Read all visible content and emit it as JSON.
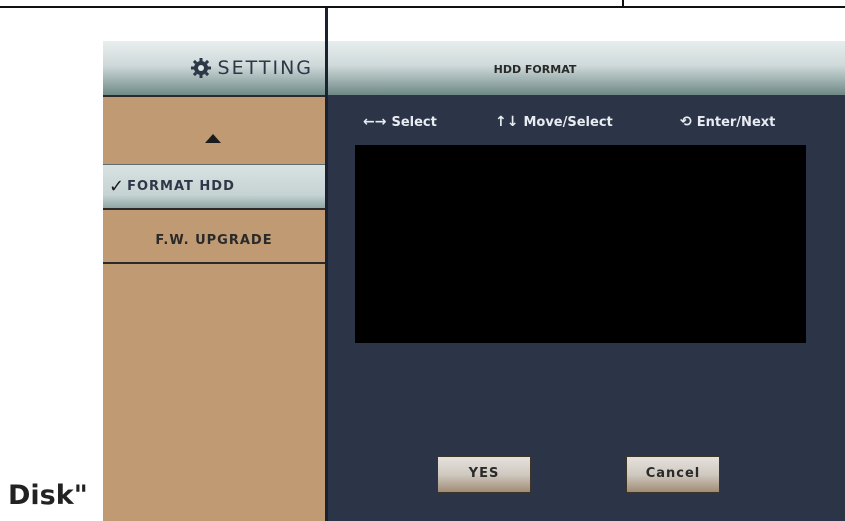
{
  "caption": "Disk\"",
  "left_panel": {
    "title": "SETTING",
    "title_icon": "gear-icon",
    "scroll_up_icon": "triangle-up-icon",
    "menu": [
      {
        "label": "FORMAT HDD",
        "selected": true,
        "marker": "✓"
      },
      {
        "label": "F.W. UPGRADE",
        "selected": false
      }
    ]
  },
  "right_panel": {
    "title": "HDD FORMAT",
    "hints": [
      {
        "icon": "←→",
        "label": "Select"
      },
      {
        "icon": "↑↓",
        "label": "Move/Select"
      },
      {
        "icon": "⟲",
        "label": "Enter/Next"
      }
    ],
    "buttons": {
      "yes": "YES",
      "cancel": "Cancel"
    }
  },
  "colors": {
    "screen_bg": "#2c3547",
    "left_panel_bg": "#c09a72",
    "header_gradient_top": "#e9eeee",
    "header_gradient_bottom": "#6f8b88",
    "content_box": "#000000"
  }
}
